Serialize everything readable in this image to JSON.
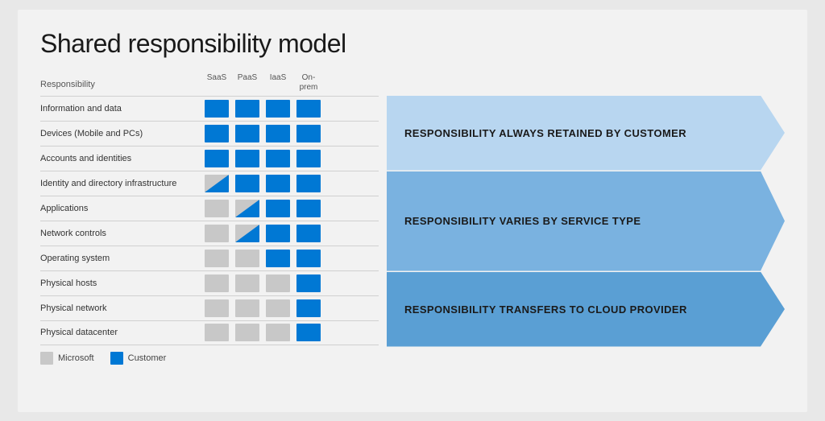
{
  "slide": {
    "title": "Shared responsibility model",
    "columns": {
      "responsibility": "Responsibility",
      "saas": "SaaS",
      "paas": "PaaS",
      "iaas": "IaaS",
      "onprem": "On-\nprem"
    },
    "rows": [
      {
        "label": "Information and data",
        "cells": [
          "blue",
          "blue",
          "blue",
          "blue"
        ]
      },
      {
        "label": "Devices (Mobile and PCs)",
        "cells": [
          "blue",
          "blue",
          "blue",
          "blue"
        ]
      },
      {
        "label": "Accounts and identities",
        "cells": [
          "blue",
          "blue",
          "blue",
          "blue"
        ]
      },
      {
        "label": "Identity and directory infrastructure",
        "cells": [
          "diag",
          "blue",
          "blue",
          "blue"
        ]
      },
      {
        "label": "Applications",
        "cells": [
          "gray",
          "diag",
          "blue",
          "blue"
        ]
      },
      {
        "label": "Network controls",
        "cells": [
          "gray",
          "diag",
          "blue",
          "blue"
        ]
      },
      {
        "label": "Operating system",
        "cells": [
          "gray",
          "gray",
          "blue",
          "blue"
        ]
      },
      {
        "label": "Physical hosts",
        "cells": [
          "gray",
          "gray",
          "gray",
          "blue"
        ]
      },
      {
        "label": "Physical network",
        "cells": [
          "gray",
          "gray",
          "gray",
          "blue"
        ]
      },
      {
        "label": "Physical datacenter",
        "cells": [
          "gray",
          "gray",
          "gray",
          "blue"
        ]
      }
    ],
    "banners": [
      {
        "id": "banner-1",
        "text": "RESPONSIBILITY ALWAYS RETAINED BY CUSTOMER",
        "row_count": 3
      },
      {
        "id": "banner-2",
        "text": "RESPONSIBILITY VARIES BY SERVICE TYPE",
        "row_count": 4
      },
      {
        "id": "banner-3",
        "text": "RESPONSIBILITY TRANSFERS TO CLOUD PROVIDER",
        "row_count": 3
      }
    ],
    "legend": {
      "microsoft_label": "Microsoft",
      "customer_label": "Customer"
    }
  }
}
